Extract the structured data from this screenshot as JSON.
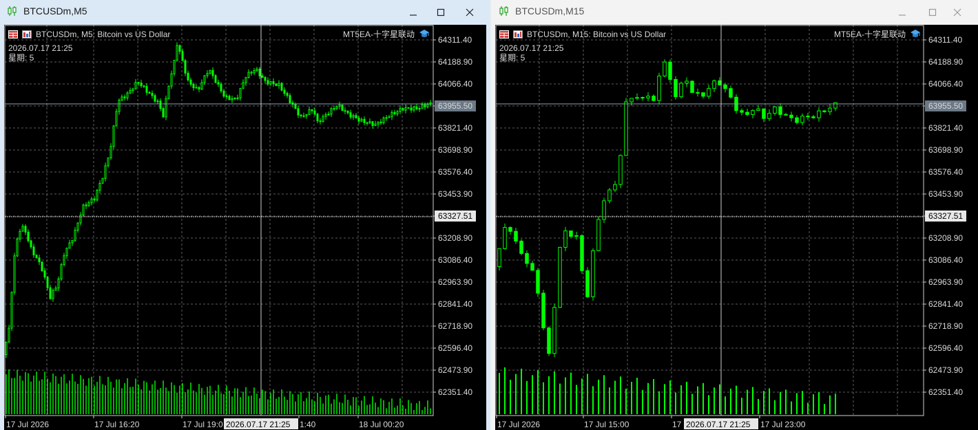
{
  "windows": [
    {
      "id": "m5",
      "title": "BTCUSDm,M5",
      "active": true,
      "header": "BTCUSDm, M5:  Bitcoin vs US Dollar",
      "ea": "MT5EA-十字星联动",
      "date_line": "2026.07.17 21:25",
      "weekday_line": "星期: 5",
      "price_labels": [
        "64311.40",
        "64188.90",
        "64066.40",
        "63955.50",
        "63821.40",
        "63698.90",
        "63576.40",
        "63453.90",
        "63327.51",
        "63208.90",
        "63086.40",
        "62963.90",
        "62841.40",
        "62718.90",
        "62596.40",
        "62473.90",
        "62351.40"
      ],
      "current_price": "63955.50",
      "crosshair_price": "63327.51",
      "time_labels": [
        "17 Jul 2026",
        "17 Jul 16:20",
        "17 Jul 19:0",
        "1:40",
        "18 Jul 00:20"
      ],
      "crosshair_time": "2026.07.17 21:25"
    },
    {
      "id": "m15",
      "title": "BTCUSDm,M15",
      "active": false,
      "header": "BTCUSDm, M15:  Bitcoin vs US Dollar",
      "ea": "MT5EA-十字星联动",
      "date_line": "2026.07.17 21:25",
      "weekday_line": "星期: 5",
      "price_labels": [
        "64311.40",
        "64188.90",
        "64066.40",
        "63955.50",
        "63821.40",
        "63698.90",
        "63576.40",
        "63453.90",
        "63327.51",
        "63208.90",
        "63086.40",
        "62963.90",
        "62841.40",
        "62718.90",
        "62596.40",
        "62473.90",
        "62351.40"
      ],
      "current_price": "63955.50",
      "crosshair_price": "63327.51",
      "time_labels": [
        "17 Jul 2026",
        "17 Jul 15:00",
        "17",
        "17 Jul 23:00"
      ],
      "crosshair_time": "2026.07.17 21:25"
    }
  ],
  "colors": {
    "bull": "#00ff00",
    "background": "#000000",
    "grid": "#7a7a7a",
    "axis_text": "#d8d8d8",
    "current_price_bg": "#6c7886",
    "crosshair_label_bg": "#e8e8e8"
  },
  "icons": {
    "title": "candlestick-icon",
    "minimize": "minimize-icon",
    "maximize": "maximize-icon",
    "close": "close-icon",
    "ea": "graduation-cap-icon"
  }
}
